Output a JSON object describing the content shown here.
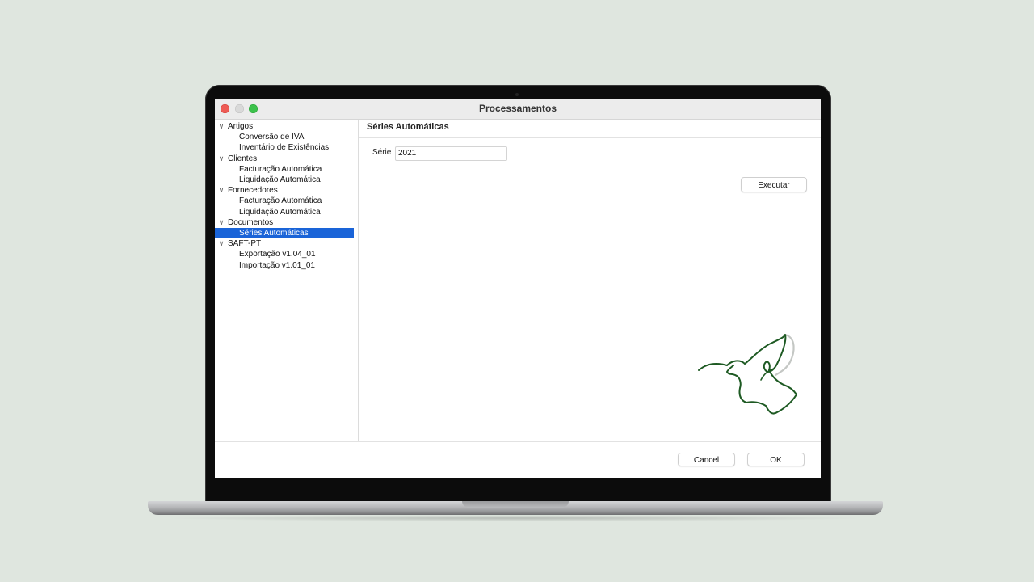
{
  "window": {
    "title": "Processamentos"
  },
  "sidebar": {
    "groups": [
      {
        "label": "Artigos",
        "items": [
          {
            "label": "Conversão de IVA"
          },
          {
            "label": "Inventário de Existências"
          }
        ]
      },
      {
        "label": "Clientes",
        "items": [
          {
            "label": "Facturação Automática"
          },
          {
            "label": "Liquidação Automática"
          }
        ]
      },
      {
        "label": "Fornecedores",
        "items": [
          {
            "label": "Facturação Automática"
          },
          {
            "label": "Liquidação Automática"
          }
        ]
      },
      {
        "label": "Documentos",
        "items": [
          {
            "label": "Séries Automáticas"
          }
        ]
      },
      {
        "label": "SAFT-PT",
        "items": [
          {
            "label": "Exportação v1.04_01"
          },
          {
            "label": "Importação v1.01_01"
          }
        ]
      }
    ],
    "selected": "Séries Automáticas",
    "expanded_glyph": "∨"
  },
  "main": {
    "section_title": "Séries Automáticas",
    "serie_label": "Série",
    "serie_value": "2021",
    "execute_label": "Executar"
  },
  "footer": {
    "cancel_label": "Cancel",
    "ok_label": "OK"
  },
  "colors": {
    "background": "#dfe6df",
    "selection": "#1a64d8",
    "bird_logo": "#1e5a23",
    "close": "#ee5b55",
    "zoom": "#3dc24c"
  },
  "icons": {
    "logo": "hummingbird-logo",
    "tree_toggle": "chevron-down-icon"
  }
}
